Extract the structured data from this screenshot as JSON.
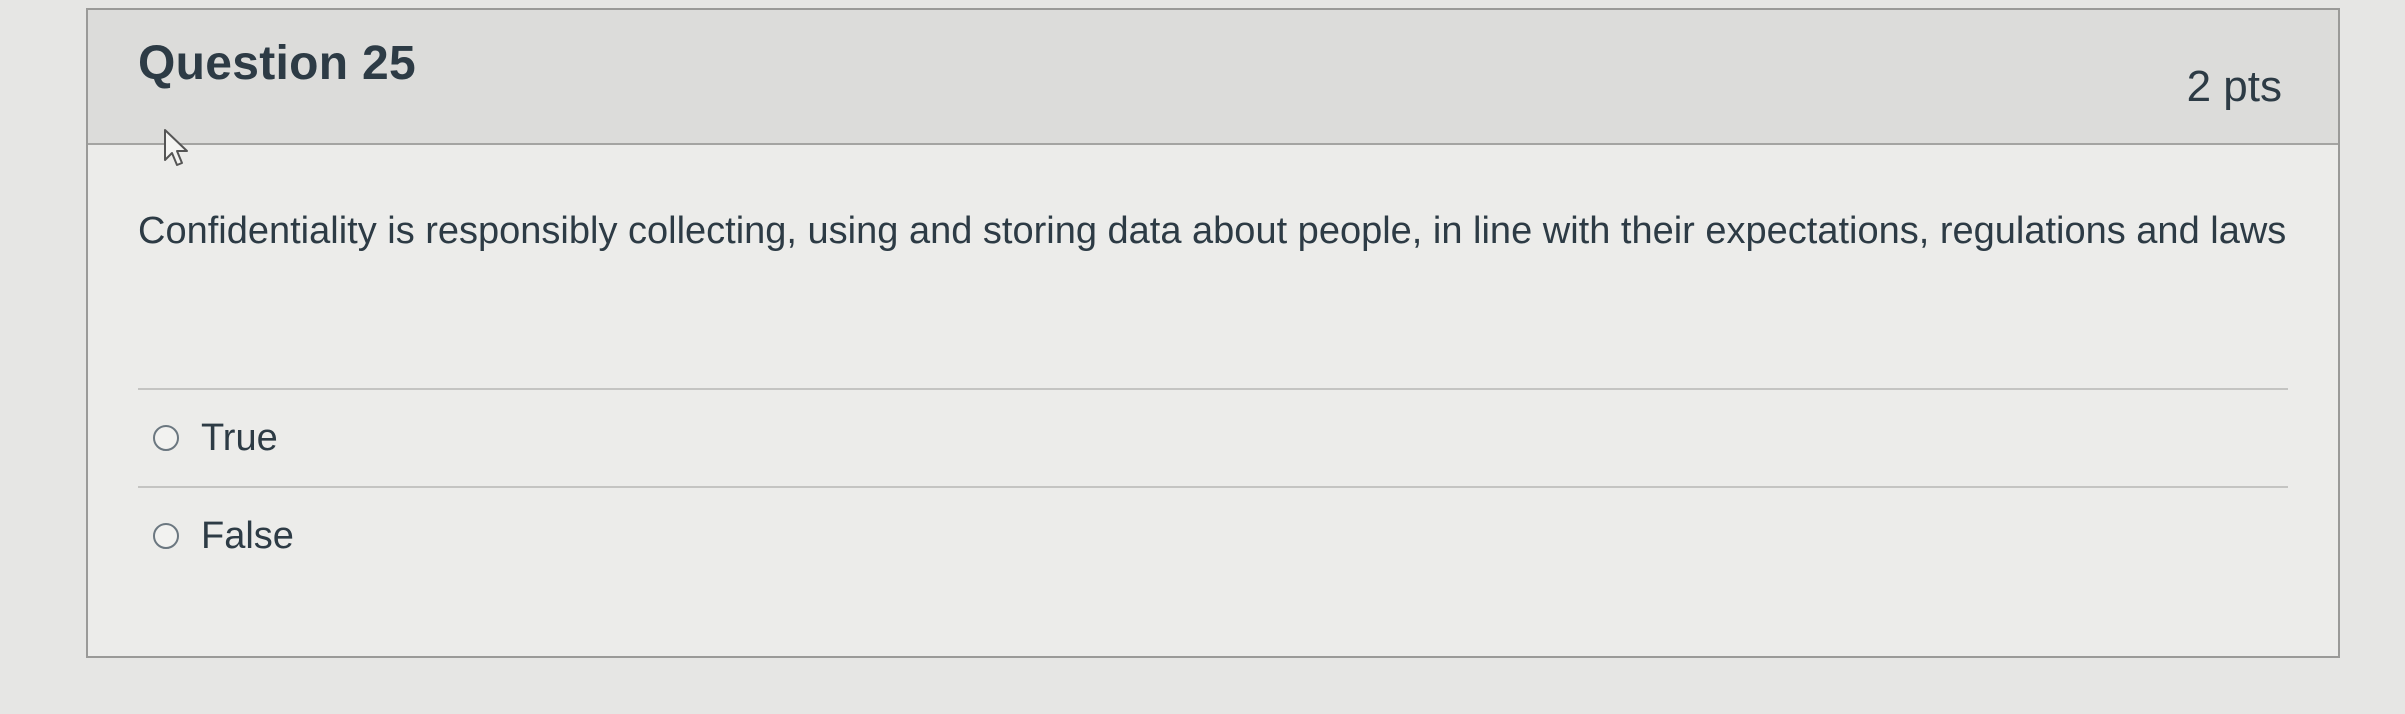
{
  "question": {
    "title": "Question 25",
    "points": "2 pts",
    "text": "Confidentiality is responsibly collecting, using and storing data about people, in line with their expectations, regulations and laws",
    "answers": [
      {
        "label": "True",
        "selected": false
      },
      {
        "label": "False",
        "selected": false
      }
    ]
  },
  "icons": {
    "cursor": "mouse-pointer-icon",
    "radio": "radio-button-icon"
  },
  "colors": {
    "background": "#e6e6e4",
    "header": "#dcdcda",
    "text": "#2d3b45"
  }
}
